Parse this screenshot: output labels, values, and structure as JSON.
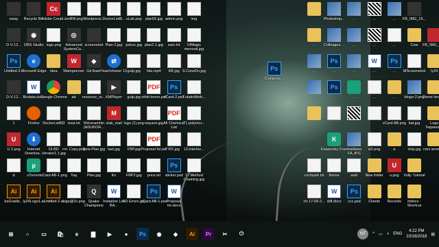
{
  "desktop": {
    "icons": [
      {
        "label": "eway",
        "kind": "dark",
        "glyph": "",
        "col": 0,
        "row": 0
      },
      {
        "label": "Recycle Bin",
        "kind": "dark",
        "glyph": "",
        "col": 1,
        "row": 0
      },
      {
        "label": "Adobe Creati...",
        "kind": "red",
        "glyph": "Cc",
        "col": 2,
        "row": 0
      },
      {
        "label": "innBW.png",
        "kind": "doc",
        "glyph": "",
        "col": 3,
        "row": 0
      },
      {
        "label": "Wordpress...",
        "kind": "doc",
        "glyph": "",
        "col": 4,
        "row": 0
      },
      {
        "label": "DoctorListB...",
        "kind": "doc",
        "glyph": "",
        "col": 5,
        "row": 0
      },
      {
        "label": "sLab.png",
        "kind": "doc",
        "glyph": "",
        "col": 6,
        "row": 0
      },
      {
        "label": "plan55.jpg",
        "kind": "doc",
        "glyph": "",
        "col": 7,
        "row": 0
      },
      {
        "label": "admin.png",
        "kind": "doc",
        "glyph": "",
        "col": 8,
        "row": 0
      },
      {
        "label": "img",
        "kind": "doc",
        "glyph": "",
        "col": 9,
        "row": 0
      },
      {
        "label": "D-V-12...",
        "kind": "dark",
        "glyph": "",
        "col": 0,
        "row": 1
      },
      {
        "label": "OBS Studio",
        "kind": "dark",
        "glyph": "◉",
        "col": 1,
        "row": 1
      },
      {
        "label": "logo.png",
        "kind": "doc",
        "glyph": "",
        "col": 2,
        "row": 1
      },
      {
        "label": "Advanced SystemCa...",
        "kind": "dark",
        "glyph": "◎",
        "col": 3,
        "row": 1
      },
      {
        "label": "screenshot",
        "kind": "dark",
        "glyph": "",
        "col": 4,
        "row": 1
      },
      {
        "label": "Plan-2.jpg",
        "kind": "doc",
        "glyph": "",
        "col": 5,
        "row": 1
      },
      {
        "label": "psiruc.jpg",
        "kind": "doc",
        "glyph": "",
        "col": 6,
        "row": 1
      },
      {
        "label": "plan2.1.jpg",
        "kind": "doc",
        "glyph": "",
        "col": 7,
        "row": 1
      },
      {
        "label": "sam.txt",
        "kind": "doc",
        "glyph": "",
        "col": 8,
        "row": 1
      },
      {
        "label": "14Magic memodi.jpg",
        "kind": "doc",
        "glyph": "",
        "col": 9,
        "row": 1
      },
      {
        "label": "Untitled-3...",
        "kind": "ps",
        "glyph": "Ps",
        "col": 0,
        "row": 2
      },
      {
        "label": "Microsoft Edge",
        "kind": "edge",
        "glyph": "e",
        "col": 1,
        "row": 2
      },
      {
        "label": "idea",
        "kind": "folder",
        "glyph": "",
        "col": 2,
        "row": 2
      },
      {
        "label": "Wampserver",
        "kind": "red",
        "glyph": "W",
        "col": 3,
        "row": 2
      },
      {
        "label": "Git Bash",
        "kind": "dark",
        "glyph": "◆",
        "col": 4,
        "row": 2
      },
      {
        "label": "TeamViewer 13",
        "kind": "edge",
        "glyph": "⇄",
        "col": 5,
        "row": 2
      },
      {
        "label": "gulp.jpg",
        "kind": "doc",
        "glyph": "",
        "col": 6,
        "row": 2
      },
      {
        "label": "like.mp4",
        "kind": "doc",
        "glyph": "",
        "col": 7,
        "row": 2
      },
      {
        "label": "KB.jpg",
        "kind": "doc",
        "glyph": "",
        "col": 8,
        "row": 2
      },
      {
        "label": "S.ConsDn.jpg",
        "kind": "doc",
        "glyph": "",
        "col": 9,
        "row": 2
      },
      {
        "label": "D-V-12...",
        "kind": "dark",
        "glyph": "",
        "col": 0,
        "row": 3
      },
      {
        "label": "Bicdata.docx",
        "kind": "word",
        "glyph": "W",
        "col": 1,
        "row": 3
      },
      {
        "label": "Google Chrome",
        "kind": "chrome",
        "glyph": "",
        "col": 2,
        "row": 3
      },
      {
        "label": "ab",
        "kind": "folder",
        "glyph": "",
        "col": 3,
        "row": 3
      },
      {
        "label": "resource_ro...",
        "kind": "doc",
        "glyph": "",
        "col": 4,
        "row": 3
      },
      {
        "label": "KMPlayer",
        "kind": "dark",
        "glyph": "▶",
        "col": 5,
        "row": 3
      },
      {
        "label": "gulp.jpg",
        "kind": "doc",
        "glyph": "",
        "col": 6,
        "row": 3
      },
      {
        "label": "othiti boron.pdf",
        "kind": "pdf",
        "glyph": "PDF",
        "col": 7,
        "row": 3
      },
      {
        "label": "vCard-2.psd",
        "kind": "ps",
        "glyph": "Ps",
        "col": 8,
        "row": 3
      },
      {
        "label": "T.staticMeth...",
        "kind": "doc",
        "glyph": "",
        "col": 9,
        "row": 3
      },
      {
        "label": "1",
        "kind": "doc",
        "glyph": "",
        "col": 0,
        "row": 4
      },
      {
        "label": "Firefox",
        "kind": "ff",
        "glyph": "",
        "col": 1,
        "row": 4
      },
      {
        "label": "DoctorListBD",
        "kind": "doc",
        "glyph": "",
        "col": 2,
        "row": 4
      },
      {
        "label": "visal.txt",
        "kind": "doc",
        "glyph": "",
        "col": 3,
        "row": 4
      },
      {
        "label": "Shironamhin (ADUKOR...",
        "kind": "doc",
        "glyph": "",
        "col": 4,
        "row": 4
      },
      {
        "label": "ulab_mail",
        "kind": "red",
        "glyph": "M",
        "col": 5,
        "row": 4
      },
      {
        "label": "logo (1).png",
        "kind": "doc",
        "glyph": "",
        "col": 6,
        "row": 4
      },
      {
        "label": "request.jpg",
        "kind": "doc",
        "glyph": "",
        "col": 7,
        "row": 4
      },
      {
        "label": "All Chemical List",
        "kind": "pdf",
        "glyph": "PDF",
        "col": 8,
        "row": 4
      },
      {
        "label": "T1.polymor...",
        "kind": "doc",
        "glyph": "",
        "col": 9,
        "row": 4
      },
      {
        "label": "U 2.png",
        "kind": "red",
        "glyph": "U",
        "col": 0,
        "row": 5
      },
      {
        "label": "Internet Downloa...",
        "kind": "edge",
        "glyph": "⬇",
        "col": 1,
        "row": 5
      },
      {
        "label": "DLBD Version1.1.jpg",
        "kind": "doc",
        "glyph": "",
        "col": 2,
        "row": 5
      },
      {
        "label": "rm- Copy.png",
        "kind": "doc",
        "glyph": "",
        "col": 3,
        "row": 5
      },
      {
        "label": "New-Plan.jpg",
        "kind": "doc",
        "glyph": "",
        "col": 4,
        "row": 5
      },
      {
        "label": "last.jpg",
        "kind": "doc",
        "glyph": "",
        "col": 5,
        "row": 5
      },
      {
        "label": "FBP.jpg",
        "kind": "doc",
        "glyph": "",
        "col": 6,
        "row": 5
      },
      {
        "label": "Proposal for.pdf",
        "kind": "pdf",
        "glyph": "PDF",
        "col": 7,
        "row": 5
      },
      {
        "label": "RX.jpg",
        "kind": "doc",
        "glyph": "",
        "col": 8,
        "row": 5
      },
      {
        "label": "12.interfac...",
        "kind": "doc",
        "glyph": "",
        "col": 9,
        "row": 5
      },
      {
        "label": "d",
        "kind": "doc",
        "glyph": "",
        "col": 0,
        "row": 6
      },
      {
        "label": "uTorrent",
        "kind": "app",
        "glyph": "µ",
        "col": 1,
        "row": 6
      },
      {
        "label": "vCard AB-1.png",
        "kind": "doc",
        "glyph": "",
        "col": 2,
        "row": 6
      },
      {
        "label": "Taq",
        "kind": "doc",
        "glyph": "",
        "col": 3,
        "row": 6
      },
      {
        "label": "Plan.jpg",
        "kind": "doc",
        "glyph": "",
        "col": 4,
        "row": 6
      },
      {
        "label": "Ko",
        "kind": "doc",
        "glyph": "",
        "col": 5,
        "row": 6
      },
      {
        "label": "FBP2.jpg",
        "kind": "doc",
        "glyph": "",
        "col": 6,
        "row": 6
      },
      {
        "label": "price.txt",
        "kind": "doc",
        "glyph": "",
        "col": 7,
        "row": 6
      },
      {
        "label": "sticker.psd",
        "kind": "ps",
        "glyph": "Ps",
        "col": 8,
        "row": 6
      },
      {
        "label": "17.Method Chaining.jpg",
        "kind": "doc",
        "glyph": "",
        "col": 9,
        "row": 6
      },
      {
        "label": "bsGradle...",
        "kind": "ai",
        "glyph": "Ai",
        "col": 0,
        "row": 7
      },
      {
        "label": "ly24Logo1.ai",
        "kind": "ai",
        "glyph": "Ai",
        "col": 1,
        "row": 7
      },
      {
        "label": "Untitled-2.ai",
        "kind": "ai",
        "glyph": "Ai",
        "col": 2,
        "row": 7
      },
      {
        "label": "logo@2x.png",
        "kind": "doc",
        "glyph": "",
        "col": 3,
        "row": 7
      },
      {
        "label": "Quake Champions",
        "kind": "dark",
        "glyph": "Q",
        "col": 4,
        "row": 7
      },
      {
        "label": "Invitation List BA...",
        "kind": "word",
        "glyph": "W",
        "col": 5,
        "row": 7
      },
      {
        "label": "AD Errors.jpg",
        "kind": "doc",
        "glyph": "",
        "col": 6,
        "row": 7
      },
      {
        "label": "vCard AB-1.psd",
        "kind": "ps",
        "glyph": "Ps",
        "col": 7,
        "row": 7
      },
      {
        "label": "Proposal for.docx",
        "kind": "word",
        "glyph": "W",
        "col": 8,
        "row": 7
      },
      {
        "label": "Compose...",
        "kind": "ps",
        "glyph": "Ps",
        "col": 13,
        "row": 2.3
      },
      {
        "label": "",
        "kind": "folder",
        "glyph": "",
        "col": 15,
        "row": 0
      },
      {
        "label": "Photoshop...",
        "kind": "img",
        "glyph": "",
        "col": 16,
        "row": 0
      },
      {
        "label": "...",
        "kind": "img",
        "glyph": "",
        "col": 17,
        "row": 0
      },
      {
        "label": "...",
        "kind": "qr",
        "glyph": "",
        "col": 18,
        "row": 0
      },
      {
        "label": "...",
        "kind": "img",
        "glyph": "",
        "col": 19,
        "row": 0
      },
      {
        "label": "FB_IMG_15...",
        "kind": "dark",
        "glyph": "",
        "col": 20,
        "row": 0
      },
      {
        "label": "...",
        "kind": "folder",
        "glyph": "",
        "col": 15,
        "row": 1
      },
      {
        "label": "Colleague ...",
        "kind": "img",
        "glyph": "",
        "col": 16,
        "row": 1
      },
      {
        "label": "...",
        "kind": "img",
        "glyph": "",
        "col": 17,
        "row": 1
      },
      {
        "label": "...",
        "kind": "qr",
        "glyph": "",
        "col": 18,
        "row": 1
      },
      {
        "label": "...",
        "kind": "doc",
        "glyph": "",
        "col": 19,
        "row": 1
      },
      {
        "label": "Cow",
        "kind": "folder",
        "glyph": "",
        "col": 20,
        "row": 1
      },
      {
        "label": "FB_IMG_15...",
        "kind": "red",
        "glyph": "",
        "col": 21,
        "row": 1
      },
      {
        "label": "...",
        "kind": "img",
        "glyph": "",
        "col": 15,
        "row": 2
      },
      {
        "label": "...",
        "kind": "ps",
        "glyph": "Ps",
        "col": 16,
        "row": 2
      },
      {
        "label": "...",
        "kind": "img",
        "glyph": "",
        "col": 17,
        "row": 2
      },
      {
        "label": "...",
        "kind": "word",
        "glyph": "W",
        "col": 18,
        "row": 2
      },
      {
        "label": "...",
        "kind": "ps",
        "glyph": "Ps",
        "col": 19,
        "row": 2
      },
      {
        "label": "MScreenshot",
        "kind": "doc",
        "glyph": "",
        "col": 20,
        "row": 2
      },
      {
        "label": "ly24",
        "kind": "folder",
        "glyph": "",
        "col": 21,
        "row": 2
      },
      {
        "label": "...",
        "kind": "img",
        "glyph": "",
        "col": 15,
        "row": 3
      },
      {
        "label": "...",
        "kind": "ps",
        "glyph": "Ps",
        "col": 16,
        "row": 3
      },
      {
        "label": "...",
        "kind": "app",
        "glyph": "",
        "col": 17,
        "row": 3
      },
      {
        "label": "...",
        "kind": "doc",
        "glyph": "",
        "col": 18,
        "row": 3
      },
      {
        "label": "...",
        "kind": "folder",
        "glyph": "",
        "col": 19,
        "row": 3
      },
      {
        "label": "blogo-2.png",
        "kind": "img",
        "glyph": "",
        "col": 20,
        "row": 3
      },
      {
        "label": "Demo Images",
        "kind": "folder",
        "glyph": "",
        "col": 21,
        "row": 3
      },
      {
        "label": "",
        "kind": "folder",
        "glyph": "",
        "col": 15,
        "row": 4
      },
      {
        "label": "",
        "kind": "doc",
        "glyph": "",
        "col": 16,
        "row": 4
      },
      {
        "label": "",
        "kind": "qr",
        "glyph": "",
        "col": 17,
        "row": 4
      },
      {
        "label": "",
        "kind": "doc",
        "glyph": "",
        "col": 18,
        "row": 4
      },
      {
        "label": "vCard AB.png",
        "kind": "doc",
        "glyph": "",
        "col": 19,
        "row": 4
      },
      {
        "label": "bat.jpg",
        "kind": "doc",
        "glyph": "",
        "col": 20,
        "row": 4
      },
      {
        "label": "Logo Taqweema",
        "kind": "folder",
        "glyph": "",
        "col": 21,
        "row": 4
      },
      {
        "label": "Kaspersky Free",
        "kind": "app",
        "glyph": "K",
        "col": 16,
        "row": 5
      },
      {
        "label": "maiilawa FA.JPG",
        "kind": "img",
        "glyph": "",
        "col": 17,
        "row": 5
      },
      {
        "label": "w2.png",
        "kind": "doc",
        "glyph": "",
        "col": 18,
        "row": 5
      },
      {
        "label": "a",
        "kind": "folder",
        "glyph": "",
        "col": 19,
        "row": 5
      },
      {
        "label": "ship.jpg",
        "kind": "doc",
        "glyph": "",
        "col": 20,
        "row": 5
      },
      {
        "label": "cms anomaly",
        "kind": "folder",
        "glyph": "",
        "col": 21,
        "row": 5
      },
      {
        "label": "cocfayek.txt",
        "kind": "doc",
        "glyph": "",
        "col": 15,
        "row": 6
      },
      {
        "label": "theme",
        "kind": "doc",
        "glyph": "",
        "col": 16,
        "row": 6
      },
      {
        "label": "web",
        "kind": "doc",
        "glyph": "",
        "col": 17,
        "row": 6
      },
      {
        "label": "New folder",
        "kind": "folder",
        "glyph": "",
        "col": 18,
        "row": 6
      },
      {
        "label": "u.png",
        "kind": "red",
        "glyph": "U",
        "col": 19,
        "row": 6
      },
      {
        "label": "Voily Tutorial",
        "kind": "folder",
        "glyph": "",
        "col": 20,
        "row": 6
      },
      {
        "label": "ch-17-09-2...",
        "kind": "doc",
        "glyph": "",
        "col": 15,
        "row": 7
      },
      {
        "label": "ddf.docx",
        "kind": "word",
        "glyph": "W",
        "col": 16,
        "row": 7
      },
      {
        "label": "ccc.psd",
        "kind": "ps",
        "glyph": "Ps",
        "col": 17,
        "row": 7
      },
      {
        "label": "Clients",
        "kind": "folder",
        "glyph": "",
        "col": 18,
        "row": 7
      },
      {
        "label": "Records",
        "kind": "folder",
        "glyph": "",
        "col": 19,
        "row": 7
      },
      {
        "label": "htdocs - Shortcut",
        "kind": "folder",
        "glyph": "",
        "col": 20,
        "row": 7
      }
    ]
  },
  "taskbar": {
    "items": [
      {
        "name": "start-icon",
        "glyph": "⊞",
        "style": ""
      },
      {
        "name": "search-icon",
        "glyph": "○",
        "style": ""
      },
      {
        "name": "task-view-icon",
        "glyph": "▭",
        "style": ""
      },
      {
        "name": "store-icon",
        "glyph": "🛍",
        "style": ""
      },
      {
        "name": "edge-icon",
        "glyph": "e",
        "style": ""
      },
      {
        "name": "explorer-icon",
        "glyph": "▇",
        "style": ""
      },
      {
        "name": "media-icon",
        "glyph": "▶",
        "style": ""
      },
      {
        "name": "firefox-icon",
        "glyph": "●",
        "style": ""
      },
      {
        "name": "photoshop-icon",
        "glyph": "Ps",
        "style": "tb-ps"
      },
      {
        "name": "chrome-icon",
        "glyph": "◉",
        "style": ""
      },
      {
        "name": "app-icon",
        "glyph": "◆",
        "style": ""
      },
      {
        "name": "illustrator-icon",
        "glyph": "Ai",
        "style": "tb-ai"
      },
      {
        "name": "premiere-icon",
        "glyph": "Pr",
        "style": "tb-pr"
      },
      {
        "name": "screenshot-icon",
        "glyph": "✂",
        "style": ""
      },
      {
        "name": "power-icon",
        "glyph": "⏻",
        "style": ""
      }
    ],
    "tray": {
      "avatar": "MT",
      "lang": "ENG",
      "time": "4:22 PM",
      "date": "10/16/2018"
    }
  }
}
